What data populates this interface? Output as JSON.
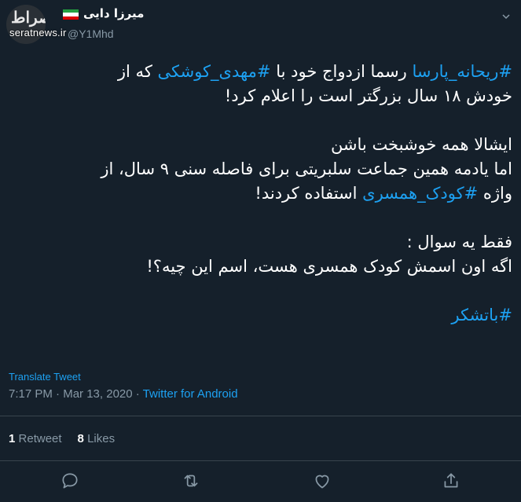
{
  "author": {
    "display_name": "میرزا دایی",
    "handle": "@Y1Mhd",
    "avatar_text": "صراط",
    "watermark": "seratnews.ir"
  },
  "tweet": {
    "line1_pre": "#",
    "line1_hashtag1": "ریحانه_پارسا",
    "line1_mid": " رسما ازدواج خود با ",
    "line1_hashtag2": "#مهدی_کوشکی",
    "line1_post": " که از",
    "line2": "خودش ۱۸ سال بزرگتر است را اعلام کرد!",
    "line3": "ایشالا همه خوشبخت باشن",
    "line4": "اما یادمه همین جماعت سلبریتی برای فاصله سنی ۹ سال، از",
    "line5_pre": "واژه ",
    "line5_hashtag": "#کودک_همسری",
    "line5_post": " استفاده کردند!",
    "line6": "فقط یه سوال :",
    "line7": "اگه اون اسمش کودک همسری هست، اسم این چیه؟!",
    "line8_hashtag": "#باتشکر"
  },
  "translate_label": "Translate Tweet",
  "meta": {
    "time": "7:17 PM",
    "sep1": " · ",
    "date": "Mar 13, 2020",
    "sep2": " · ",
    "source": "Twitter for Android"
  },
  "stats": {
    "retweets_count": "1",
    "retweets_label": "Retweet",
    "likes_count": "8",
    "likes_label": "Likes"
  },
  "actions": [
    "reply-icon",
    "retweet-icon",
    "like-icon",
    "share-icon"
  ],
  "colors": {
    "background": "#15202b",
    "accent": "#1da1f2",
    "secondary_text": "#8899a6",
    "divider": "#38444d"
  }
}
